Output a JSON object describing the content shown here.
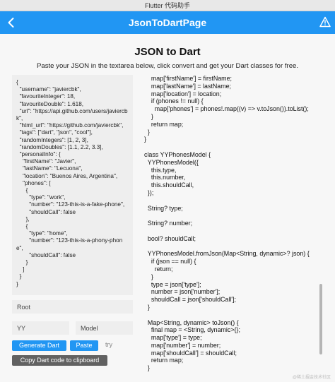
{
  "window": {
    "title": "Flutter 代码助手"
  },
  "appbar": {
    "title": "JsonToDartPage"
  },
  "header": {
    "title": "JSON to Dart",
    "subtitle": "Paste your JSON in the textarea below, click convert and get your Dart classes for free."
  },
  "json_input": {
    "value": "{\n  \"username\": \"javiercbk\",\n  \"favouriteInteger\": 18,\n  \"favouriteDouble\": 1.618,\n  \"url\": \"https://api.github.com/users/javiercbk\",\n  \"html_url\": \"https://github.com/javiercbk\",\n  \"tags\": [\"dart\", \"json\", \"cool\"],\n  \"randomIntegers\": [1, 2, 3],\n  \"randomDoubles\": [1.1, 2.2, 3.3],\n  \"personalInfo\": {\n    \"firstName\": \"Javier\",\n    \"lastName\": \"Lecuona\",\n    \"location\": \"Buenos Aires, Argentina\",\n    \"phones\": [\n      {\n        \"type\": \"work\",\n        \"number\": \"123-this-is-a-fake-phone\",\n        \"shouldCall\": false\n      },\n      {\n        \"type\": \"home\",\n        \"number\": \"123-this-is-a-phony-phone\",\n        \"shouldCall\": false\n      }\n    ]\n  }\n}"
  },
  "root_field": {
    "value": "Root"
  },
  "prefix_field": {
    "value": "YY"
  },
  "suffix_field": {
    "value": "Model"
  },
  "buttons": {
    "generate": "Generate Dart",
    "paste": "Paste",
    "try": "try",
    "copy": "Copy Dart code to clipboard"
  },
  "output_code": "    map['firstName'] = firstName;\n    map['lastName'] = lastName;\n    map['location'] = location;\n    if (phones != null) {\n      map['phones'] = phones!.map((v) => v.toJson()).toList();\n    }\n    return map;\n  }\n}\n\nclass YYPhonesModel {\n  YYPhonesModel({\n    this.type,\n    this.number,\n    this.shouldCall,\n  });\n\n  String? type;\n\n  String? number;\n\n  bool? shouldCall;\n\n  YYPhonesModel.fromJson(Map<String, dynamic>? json) {\n    if (json == null) {\n      return;\n    }\n    type = json['type'];\n    number = json['number'];\n    shouldCall = json['shouldCall'];\n  }\n\n  Map<String, dynamic> toJson() {\n    final map = <String, dynamic>{};\n    map['type'] = type;\n    map['number'] = number;\n    map['shouldCall'] = shouldCall;\n    return map;\n  }\n}",
  "watermark": "@稀土掘金技术社区"
}
